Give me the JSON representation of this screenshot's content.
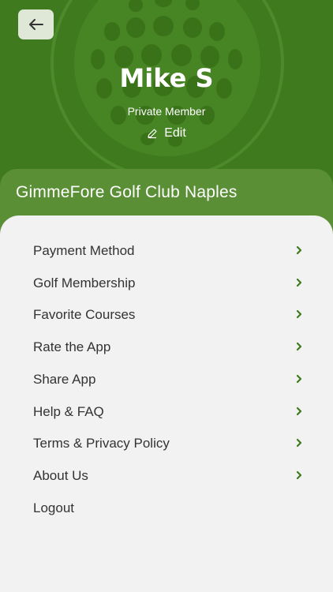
{
  "profile": {
    "name": "Mike S",
    "role": "Private Member",
    "edit_label": "Edit"
  },
  "club": {
    "name": "GimmeFore Golf Club Naples"
  },
  "menu": {
    "items": [
      {
        "label": "Payment Method",
        "has_chevron": true
      },
      {
        "label": "Golf Membership",
        "has_chevron": true
      },
      {
        "label": "Favorite Courses",
        "has_chevron": true
      },
      {
        "label": "Rate the App",
        "has_chevron": true
      },
      {
        "label": "Share App",
        "has_chevron": true
      },
      {
        "label": "Help & FAQ",
        "has_chevron": true
      },
      {
        "label": "Terms & Privacy Policy",
        "has_chevron": true
      },
      {
        "label": "About Us",
        "has_chevron": true
      },
      {
        "label": "Logout",
        "has_chevron": false
      }
    ]
  },
  "icons": {
    "back": "arrow-left-icon",
    "edit": "pencil-icon",
    "chevron": "chevron-right-icon",
    "background": "golf-ball-icon"
  },
  "colors": {
    "header_green": "#3f7a1f",
    "club_bar_green": "#5a8f36",
    "panel_bg": "#f2f2f2",
    "chevron_green": "#3f7a1f"
  }
}
